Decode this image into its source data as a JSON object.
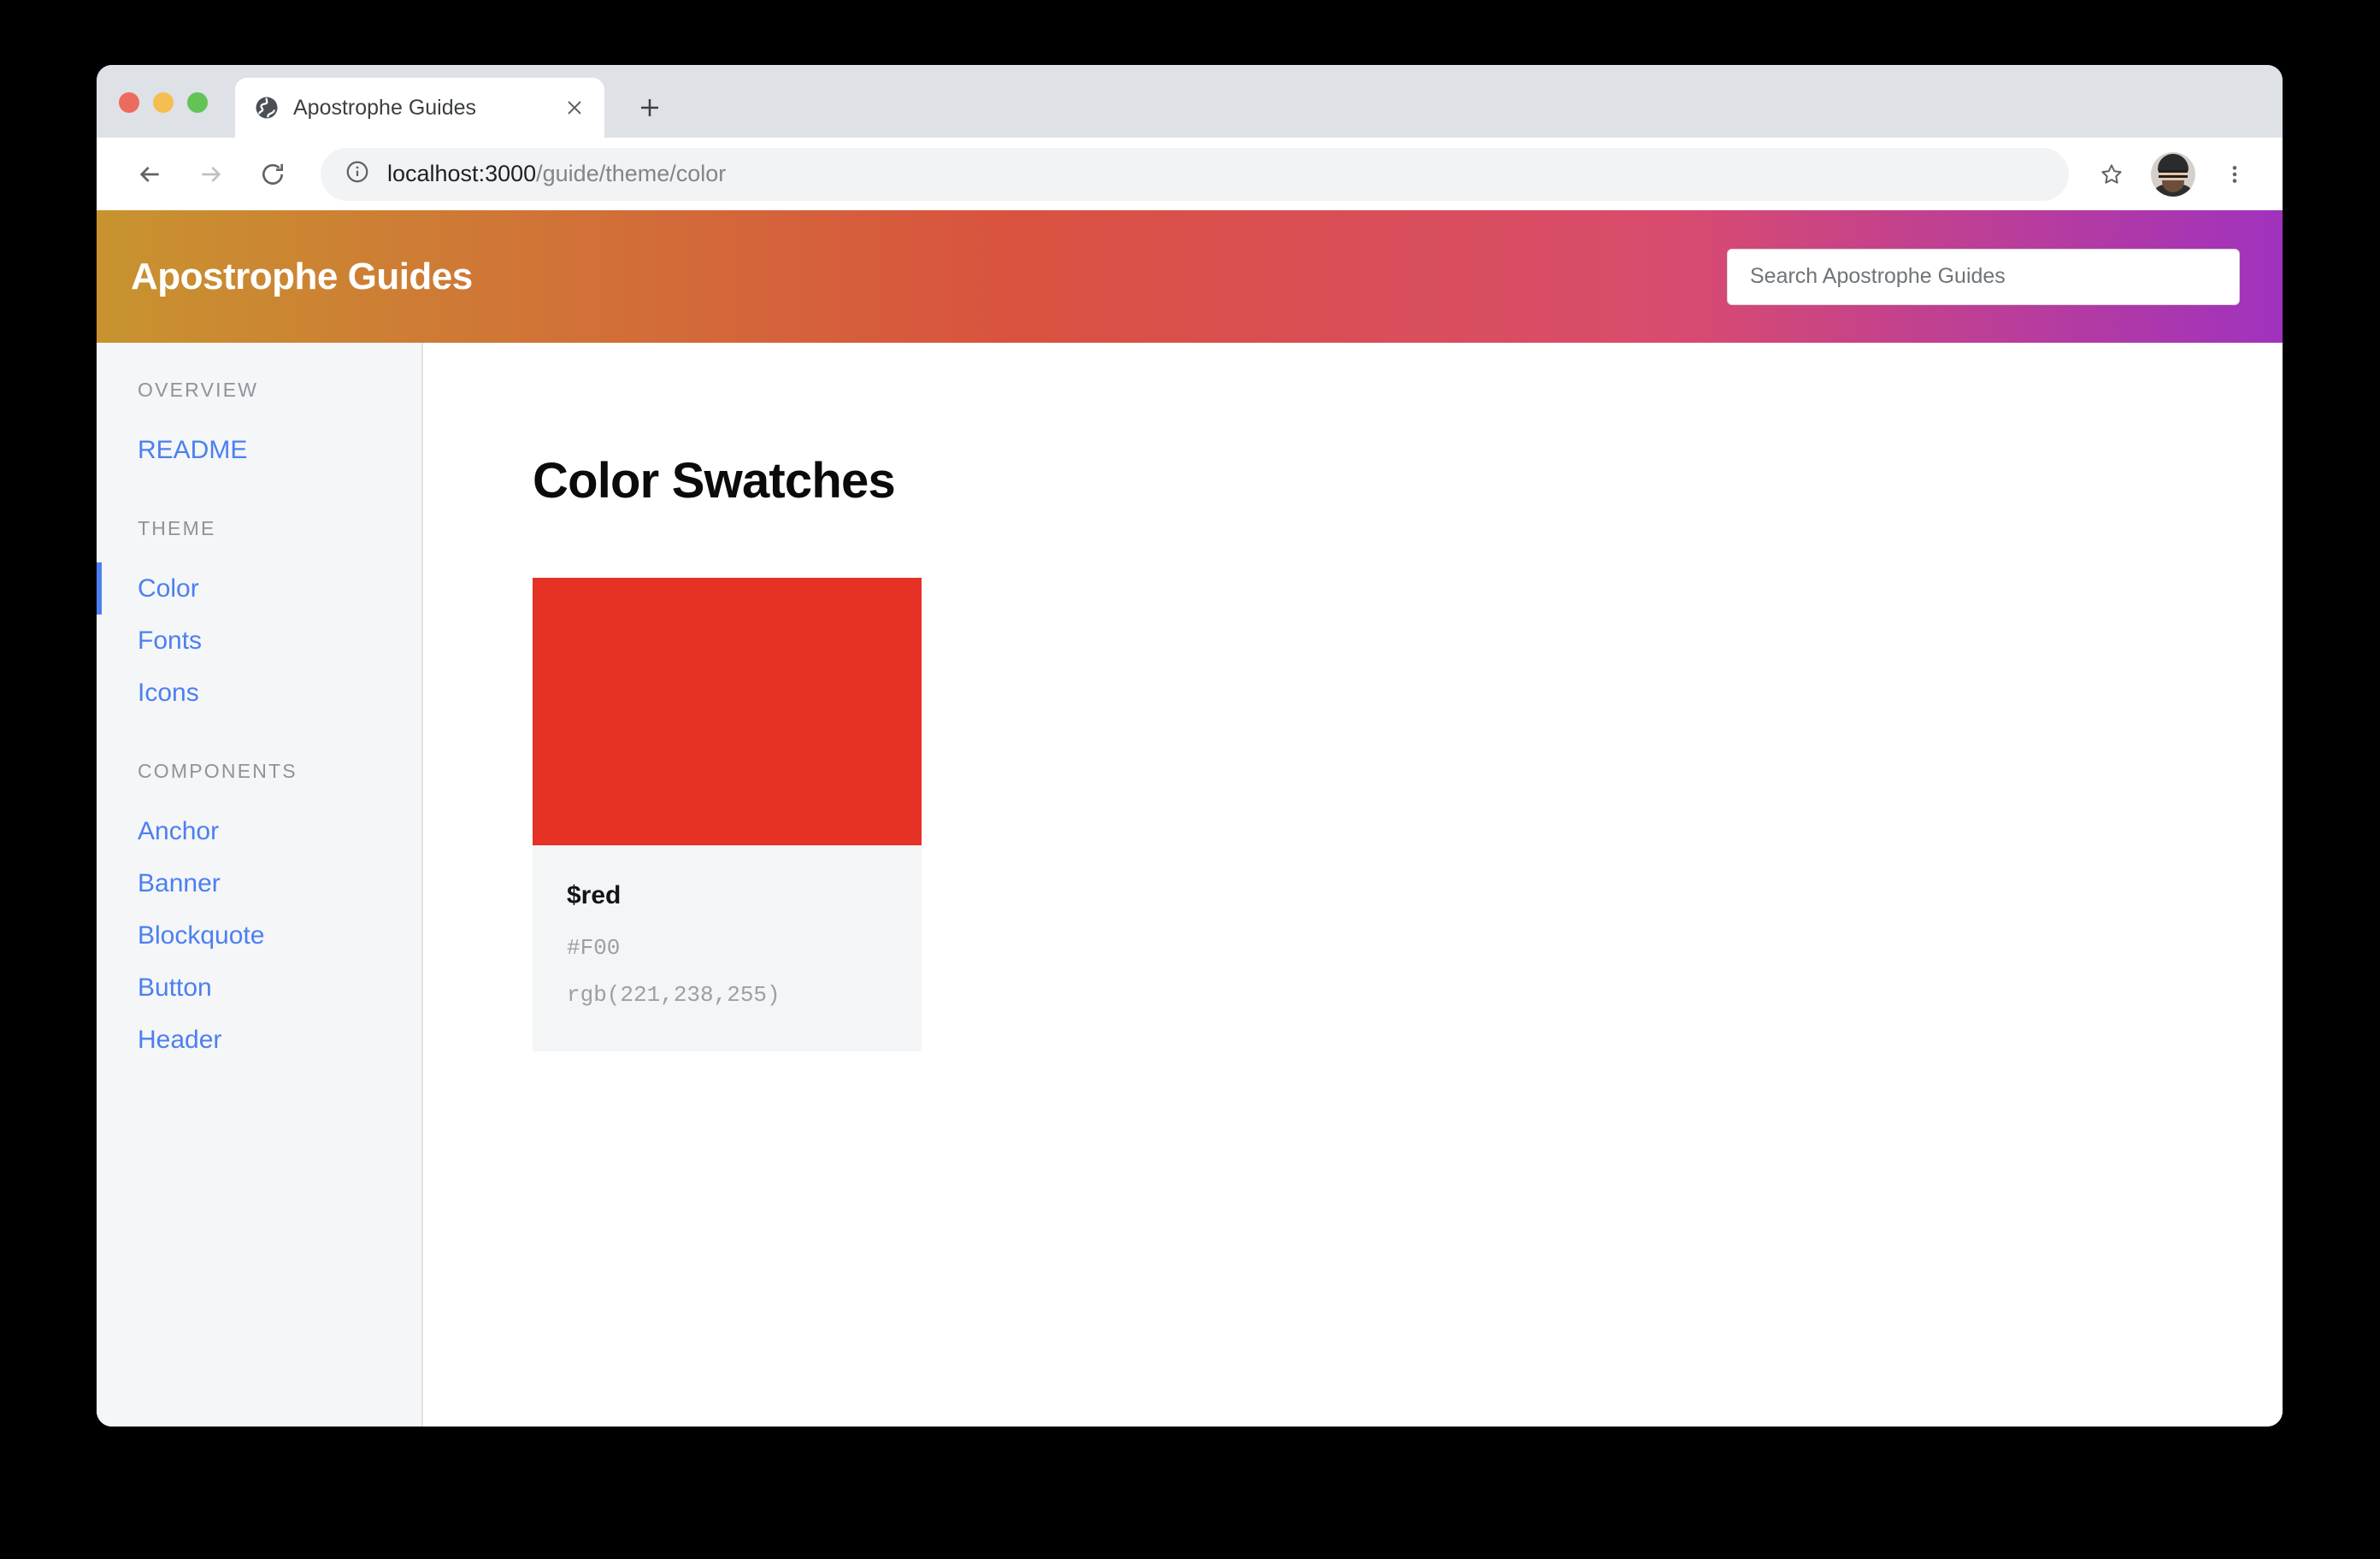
{
  "browser": {
    "tab": {
      "title": "Apostrophe Guides",
      "favicon": "globe-icon",
      "close_label": "×"
    },
    "new_tab_label": "+",
    "omnibox": {
      "url_host": "localhost:3000",
      "url_path": "/guide/theme/color",
      "info_icon": "info-circle-icon"
    },
    "back_label": "←",
    "forward_label": "→",
    "reload_label": "⟳",
    "star_icon": "bookmark-star-icon",
    "menu_icon": "three-dot-menu-icon",
    "avatar_name": "profile-avatar"
  },
  "header": {
    "title": "Apostrophe Guides",
    "gradient_start": "#C8932F",
    "gradient_mid": "#D9523F",
    "gradient_end": "#A032BE"
  },
  "search": {
    "placeholder": "Search Apostrophe Guides",
    "value": ""
  },
  "sidebar": {
    "accent_color": "#4C7FF0",
    "sections": [
      {
        "title": "OVERVIEW",
        "items": [
          {
            "label": "README",
            "active": false
          }
        ]
      },
      {
        "title": "THEME",
        "items": [
          {
            "label": "Color",
            "active": true
          },
          {
            "label": "Fonts",
            "active": false
          },
          {
            "label": "Icons",
            "active": false
          }
        ]
      },
      {
        "title": "COMPONENTS",
        "items": [
          {
            "label": "Anchor",
            "active": false
          },
          {
            "label": "Banner",
            "active": false
          },
          {
            "label": "Blockquote",
            "active": false
          },
          {
            "label": "Button",
            "active": false
          },
          {
            "label": "Header",
            "active": false
          }
        ]
      }
    ]
  },
  "main": {
    "page_title": "Color Swatches",
    "swatches": [
      {
        "name": "$red",
        "hex": "#F00",
        "rgb": "rgb(221,238,255)",
        "display_color": "#E63125"
      }
    ]
  }
}
